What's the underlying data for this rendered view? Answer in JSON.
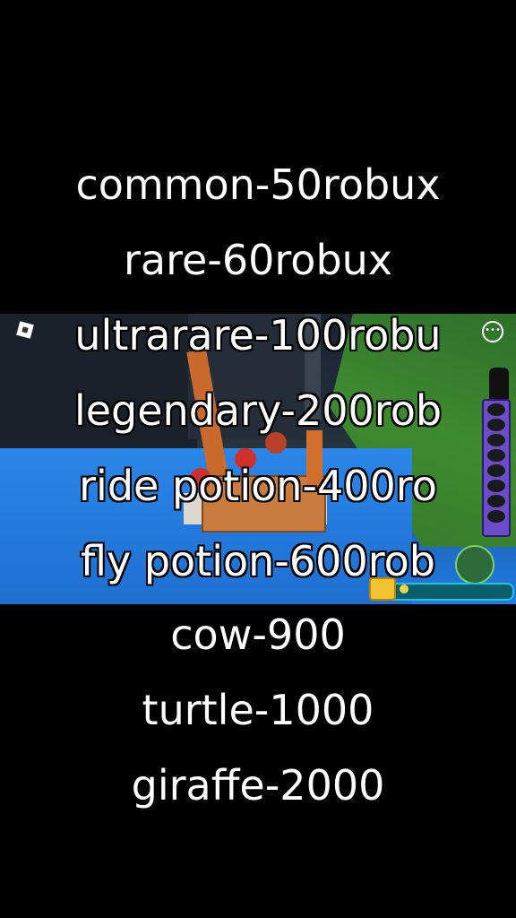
{
  "price_list": [
    "common-50robux",
    "rare-60robux",
    "ultrarare-100robu",
    "legendary-200rob",
    "ride potion-400ro",
    "fly potion-600rob",
    "cow-900",
    "turtle-1000",
    "giraffe-2000"
  ],
  "game": {
    "menu_icon": "more-options-icon",
    "logo_icon": "roblox-logo-icon",
    "coin_icon": "coin-icon"
  },
  "colors": {
    "caption": "#ffffff",
    "hotbar": "#6b4cc9",
    "coin_bar": "#20c3d8"
  }
}
